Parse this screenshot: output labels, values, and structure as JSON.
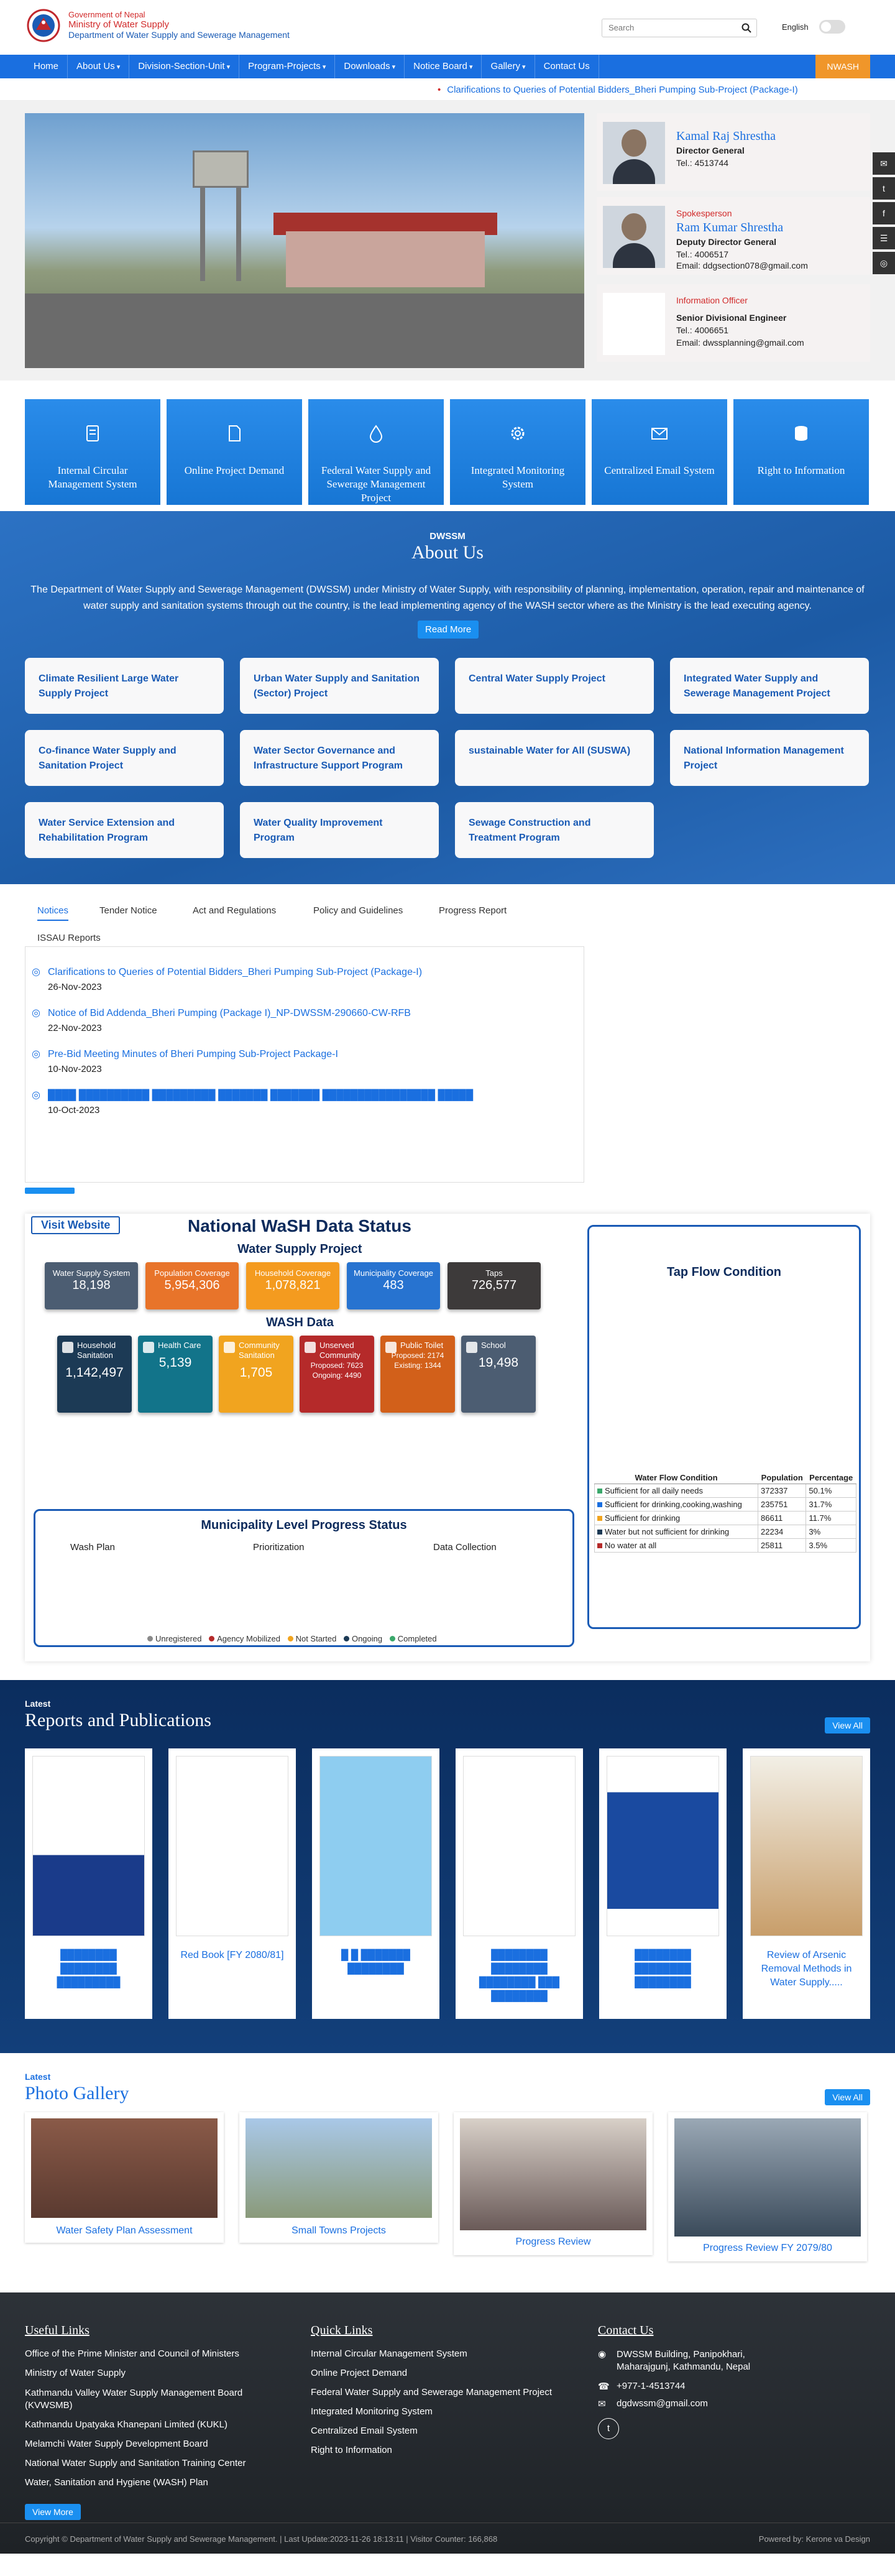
{
  "header": {
    "line1": "Government of Nepal",
    "line2": "Ministry of Water Supply",
    "line3": "Department of Water Supply and Sewerage Management",
    "search_placeholder": "Search",
    "language": "English"
  },
  "nav": {
    "items": [
      "Home",
      "About Us",
      "Division-Section-Unit",
      "Program-Projects",
      "Downloads",
      "Notice Board",
      "Gallery",
      "Contact Us"
    ],
    "wash": "NWASH"
  },
  "ticker": "Clarifications to Queries of Potential Bidders_Bheri Pumping Sub-Project (Package-I)",
  "people": [
    {
      "role": "",
      "name": "Kamal Raj Shrestha",
      "title": "Director General",
      "tel": "Tel.: 4513744",
      "email": ""
    },
    {
      "role": "Spokesperson",
      "name": "Ram Kumar Shrestha",
      "title": "Deputy Director General",
      "tel": "Tel.: 4006517",
      "email": "Email: ddgsection078@gmail.com"
    },
    {
      "role": "Information Officer",
      "name": "",
      "title": "Senior Divisional Engineer",
      "tel": "Tel.: 4006651",
      "email": "Email: dwssplanning@gmail.com"
    }
  ],
  "services": [
    "Internal Circular Management System",
    "Online Project Demand",
    "Federal Water Supply and Sewerage Management Project",
    "Integrated Monitoring System",
    "Centralized Email System",
    "Right to Information"
  ],
  "about": {
    "kicker": "DWSSM",
    "title": "About Us",
    "text": "The Department of Water Supply and Sewerage Management (DWSSM) under Ministry of Water Supply, with responsibility of planning, implementation, operation, repair and maintenance of water supply and sanitation systems through out the country, is the lead implementing agency of the WASH sector where as the Ministry is the lead executing agency.",
    "read_more": "Read More"
  },
  "projects": [
    "Climate Resilient Large Water Supply Project",
    "Urban Water Supply and Sanitation (Sector) Project",
    "Central Water Supply Project",
    "Integrated Water Supply and Sewerage Management Project",
    "Co-finance Water Supply and Sanitation Project",
    "Water Sector Governance and Infrastructure Support Program",
    "sustainable Water for All (SUSWA)",
    "National Information Management Project",
    "Water Service Extension and Rehabilitation Program",
    "Water Quality Improvement Program",
    "Sewage Construction and Treatment Program"
  ],
  "tabs": [
    "Notices",
    "Tender Notice",
    "Act and Regulations",
    "Policy and Guidelines",
    "Progress Report",
    "ISSAU Reports"
  ],
  "notices": [
    {
      "title": "Clarifications to Queries of Potential Bidders_Bheri Pumping Sub-Project (Package-I)",
      "date": "26-Nov-2023"
    },
    {
      "title": "Notice of Bid Addenda_Bheri Pumping (Package I)_NP-DWSSM-290660-CW-RFB",
      "date": "22-Nov-2023"
    },
    {
      "title": "Pre-Bid Meeting Minutes of Bheri Pumping Sub-Project Package-I",
      "date": "10-Nov-2023"
    },
    {
      "title": "████ ██████████ █████████ ███████ ███████ ████████████████ █████",
      "date": "10-Oct-2023"
    }
  ],
  "wash": {
    "visit": "Visit Website",
    "title": "National WaSH Data Status",
    "ws_heading": "Water Supply Project",
    "ws_stats": [
      {
        "label": "Water Supply System",
        "value": "18,198",
        "color": "#4c5d72"
      },
      {
        "label": "Population Coverage",
        "value": "5,954,306",
        "color": "#e8742a"
      },
      {
        "label": "Household Coverage",
        "value": "1,078,821",
        "color": "#f49b1f"
      },
      {
        "label": "Municipality Coverage",
        "value": "483",
        "color": "#2773d0"
      },
      {
        "label": "Taps",
        "value": "726,577",
        "color": "#3d3a3a"
      }
    ],
    "wash_heading": "WASH Data",
    "wash_stats": [
      {
        "label": "Household Sanitation",
        "value": "1,142,497",
        "sub1": "",
        "sub2": "",
        "color": "#1c3a55"
      },
      {
        "label": "Health Care",
        "value": "5,139",
        "sub1": "",
        "sub2": "",
        "color": "#12748a"
      },
      {
        "label": "Community Sanitation",
        "value": "1,705",
        "sub1": "",
        "sub2": "",
        "color": "#f1a41f"
      },
      {
        "label": "Unserved Community",
        "value": "",
        "sub1": "Proposed: 7623",
        "sub2": "Ongoing: 4490",
        "color": "#b52a2a"
      },
      {
        "label": "Public Toilet",
        "value": "",
        "sub1": "Proposed: 2174",
        "sub2": "Existing: 1344",
        "color": "#d2601a"
      },
      {
        "label": "School",
        "value": "19,498",
        "sub1": "",
        "sub2": "",
        "color": "#4c5d72"
      }
    ],
    "muni_title": "Municipality Level Progress Status",
    "muni_cols": [
      "Wash Plan",
      "Prioritization",
      "Data Collection"
    ],
    "legend": [
      {
        "label": "Unregistered",
        "color": "#8a8a8a"
      },
      {
        "label": "Agency Mobilized",
        "color": "#b52a2a"
      },
      {
        "label": "Not Started",
        "color": "#f1a41f"
      },
      {
        "label": "Ongoing",
        "color": "#1c3a55"
      },
      {
        "label": "Completed",
        "color": "#3aa86b"
      }
    ],
    "tap_title": "Tap Flow Condition",
    "tap_headers": [
      "Water Flow Condition",
      "Population",
      "Percentage"
    ],
    "tap_rows": [
      {
        "c": "Sufficient for all daily needs",
        "p": "372337",
        "pct": "50.1%",
        "color": "#3aa86b"
      },
      {
        "c": "Sufficient for drinking,cooking,washing",
        "p": "235751",
        "pct": "31.7%",
        "color": "#1a6fe0"
      },
      {
        "c": "Sufficient for drinking",
        "p": "86611",
        "pct": "11.7%",
        "color": "#f1a41f"
      },
      {
        "c": "Water but not sufficient for drinking",
        "p": "22234",
        "pct": "3%",
        "color": "#1c3a55"
      },
      {
        "c": "No water at all",
        "p": "25811",
        "pct": "3.5%",
        "color": "#b52a2a"
      }
    ]
  },
  "reports": {
    "kicker": "Latest",
    "title": "Reports and Publications",
    "view_all": "View All",
    "items": [
      "████████ ████████ █████████",
      "Red Book [FY 2080/81]",
      "█ █ ███████ ████████",
      "████████ ████████ ████████ ███ ████████",
      "████████ ████████ ████████",
      "Review of Arsenic Removal Methods in Water Supply....."
    ]
  },
  "gallery": {
    "kicker": "Latest",
    "title": "Photo Gallery",
    "view_all": "View All",
    "items": [
      "Water Safety Plan Assessment",
      "Small Towns Projects",
      "Progress Review",
      "Progress Review FY 2079/80"
    ]
  },
  "footer": {
    "useful_title": "Useful Links",
    "useful": [
      "Office of the Prime Minister and Council of Ministers",
      "Ministry of Water Supply",
      "Kathmandu Valley Water Supply Management Board (KVWSMB)",
      "Kathmandu Upatyaka Khanepani Limited (KUKL)",
      "Melamchi Water Supply Development Board",
      "National Water Supply and Sanitation Training Center",
      "Water, Sanitation and Hygiene (WASH) Plan"
    ],
    "view_more": "View More",
    "quick_title": "Quick Links",
    "quick": [
      "Internal Circular Management System",
      "Online Project Demand",
      "Federal Water Supply and Sewerage Management Project",
      "Integrated Monitoring System",
      "Centralized Email System",
      "Right to Information"
    ],
    "contact_title": "Contact Us",
    "address": "DWSSM Building, Panipokhari, Maharajgunj, Kathmandu, Nepal",
    "phone": "+977-1-4513744",
    "email": "dgdwssm@gmail.com",
    "copyright": "Copyright © Department of Water Supply and Sewerage Management. | Last Update:2023-11-26 18:13:11 | Visitor Counter: 166,868",
    "powered": "Powered by: Kerone va Design"
  }
}
